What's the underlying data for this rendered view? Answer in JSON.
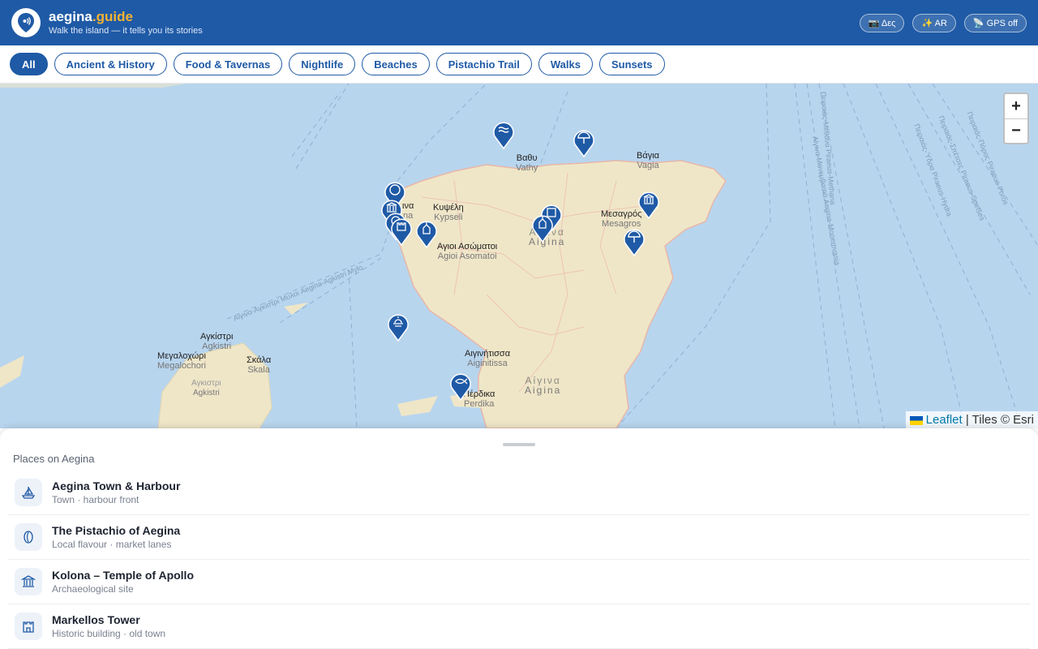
{
  "header": {
    "brand_main": "aegina",
    "brand_accent": ".guide",
    "tagline": "Walk the island — it tells you its stories",
    "actions": [
      {
        "icon": "camera-icon",
        "label": "📷 Δες"
      },
      {
        "icon": "sparkles-icon",
        "label": "✨ AR"
      },
      {
        "icon": "satellite-icon",
        "label": "📡 GPS off"
      }
    ]
  },
  "filters": [
    "All",
    "Ancient & History",
    "Food & Tavernas",
    "Nightlife",
    "Beaches",
    "Pistachio Trail",
    "Walks",
    "Sunsets"
  ],
  "map": {
    "labels": {
      "vathy_gr": "Βαθυ",
      "vathy_en": "Vathy",
      "vagia_gr": "Βάγια",
      "vagia_en": "Vagia",
      "kypseli_gr": "Κυψέλη",
      "kypseli_en": "Kypseli",
      "aegina_town_gr": "ινα",
      "aegina_town_en": "na",
      "asomatoi_gr": "Αγιοι Ασώματοι",
      "asomatoi_en": "Agioi Asomatoi",
      "aegina_mid_gr": "Αιγινα",
      "aegina_mid_en": "Aigina",
      "mesagros_gr": "Μεσαγρός",
      "mesagros_en": "Mesagros",
      "agkistri_gr": "Αγκίστρι",
      "agkistri_en": "Agkistri",
      "megalochori_gr": "Μεγαλοχώρι",
      "megalochori_en": "Megalochori",
      "skala_gr": "Σκάλα",
      "skala_en": "Skala",
      "agkistri_isl_gr": "Αγκιστρι",
      "agkistri_isl_en": "Agkistri",
      "aiginitissa_gr": "Αιγινήτισσα",
      "aiginitissa_en": "Aiginitissa",
      "perdika_gr": "Πέρδικα",
      "perdika_en": "Perdika",
      "aegina_south_gr": "Αίγινα",
      "aegina_south_en": "Aigina",
      "ferry_route": "Αίγινα-Αγκίστρι Μυλοι Aegina-Agkistri Mylo",
      "route_piraeus_1": "Πειραιάς-Πόρος Piraeus-Poros",
      "route_piraeus_2": "Πειραιάς-Σπέτσες Piraeus-Spetses",
      "route_piraeus_3": "Πειραιάς-Ύδρα Piraeus-Hydra",
      "route_methana": "Πειραιάς-Μέθανα Piraeus-Methana",
      "route_aegina": "Αίγινα-Μονεμβασιά Aegina-Monemvasia"
    },
    "zoom_in": "+",
    "zoom_out": "−",
    "attribution_link": "Leaflet",
    "attribution_rest": " | Tiles © Esri"
  },
  "places": {
    "title": "Places on Aegina",
    "items": [
      {
        "icon": "sailboat-icon",
        "title": "Aegina Town & Harbour",
        "subtitle": "Town · harbour front"
      },
      {
        "icon": "pistachio-icon",
        "title": "The Pistachio of Aegina",
        "subtitle": "Local flavour · market lanes"
      },
      {
        "icon": "temple-icon",
        "title": "Kolona – Temple of Apollo",
        "subtitle": "Archaeological site"
      },
      {
        "icon": "castle-icon",
        "title": "Markellos Tower",
        "subtitle": "Historic building · old town"
      }
    ]
  },
  "colors": {
    "brand": "#1f5aa6",
    "accent": "#f2b233",
    "sea": "#b8d5ee",
    "land": "#efe6c8"
  }
}
